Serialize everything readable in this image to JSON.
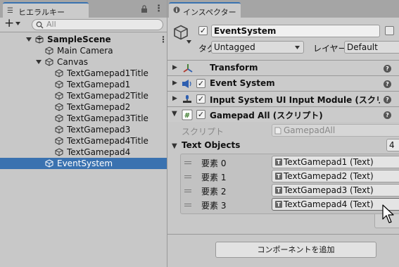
{
  "hierarchy": {
    "tab_title": "ヒエラルキー",
    "search_placeholder": "All",
    "add_label": "+",
    "rows": [
      {
        "label": "SampleScene"
      },
      {
        "label": "Main Camera"
      },
      {
        "label": "Canvas"
      },
      {
        "label": "TextGamepad1Title"
      },
      {
        "label": "TextGamepad1"
      },
      {
        "label": "TextGamepad2Title"
      },
      {
        "label": "TextGamepad2"
      },
      {
        "label": "TextGamepad3Title"
      },
      {
        "label": "TextGamepad3"
      },
      {
        "label": "TextGamepad4Title"
      },
      {
        "label": "TextGamepad4"
      },
      {
        "label": "EventSystem"
      }
    ]
  },
  "inspector": {
    "tab_title": "インスペクター",
    "object_name": "EventSystem",
    "tag_label": "タグ",
    "tag_value": "Untagged",
    "layer_label": "レイヤー",
    "layer_value": "Default",
    "components": [
      {
        "name": "Transform"
      },
      {
        "name": "Event System"
      },
      {
        "name": "Input System UI Input Module (スクリプ"
      },
      {
        "name": "Gamepad All (スクリプト)"
      }
    ],
    "script_label": "スクリプト",
    "script_value": "GamepadAll",
    "list_label": "Text Objects",
    "list_count": "4",
    "elements": [
      {
        "label": "要素 0",
        "value": "TextGamepad1 (Text)"
      },
      {
        "label": "要素 1",
        "value": "TextGamepad2 (Text)"
      },
      {
        "label": "要素 2",
        "value": "TextGamepad3 (Text)"
      },
      {
        "label": "要素 3",
        "value": "TextGamepad4 (Text)"
      }
    ],
    "add_component_label": "コンポーネントを追加",
    "help_glyph": "?"
  },
  "colors": {
    "selection": "#3a72b0",
    "panel_bg": "#c8c8c8",
    "field_bg": "#e4e4e4"
  }
}
